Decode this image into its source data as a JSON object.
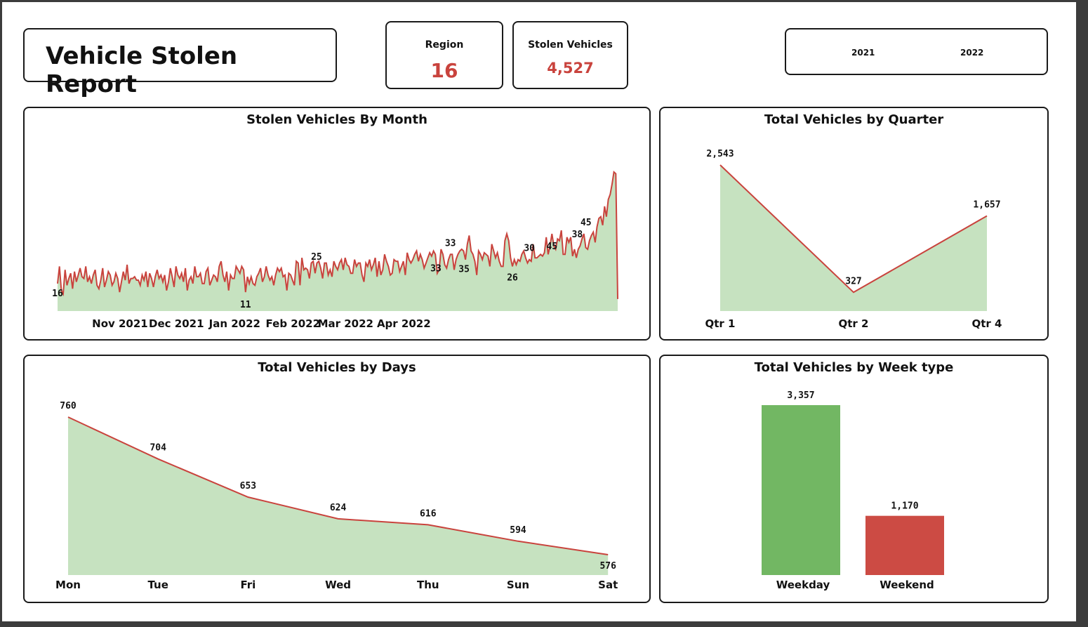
{
  "report": {
    "title": "Vehicle Stolen Report"
  },
  "kpis": {
    "region_label": "Region",
    "region_value": "16",
    "stolen_label": "Stolen Vehicles",
    "stolen_value": "4,527"
  },
  "year_slicer": {
    "options": [
      "2021",
      "2022"
    ]
  },
  "colors": {
    "area": "#c6e2c0",
    "line": "#c9433d",
    "weekday": "#72b763",
    "weekend": "#cc4b44"
  },
  "chart_data": [
    {
      "type": "area",
      "title": "Stolen Vehicles By Month",
      "x_ticks": [
        "Nov 2021",
        "Dec 2021",
        "Jan 2022",
        "Feb 2022",
        "Mar 2022",
        "Apr 2022"
      ],
      "start_date": "2021-10-07",
      "values": [
        16,
        26,
        12,
        10,
        24,
        15,
        19,
        22,
        13,
        23,
        17,
        21,
        25,
        20,
        19,
        26,
        17,
        20,
        16,
        21,
        24,
        15,
        13,
        18,
        25,
        14,
        18,
        23,
        21,
        15,
        17,
        22,
        19,
        11,
        17,
        23,
        18,
        27,
        16,
        19,
        19,
        20,
        18,
        18,
        15,
        21,
        18,
        23,
        14,
        22,
        19,
        14,
        20,
        24,
        19,
        21,
        17,
        21,
        12,
        17,
        25,
        20,
        14,
        26,
        21,
        19,
        22,
        17,
        25,
        12,
        18,
        20,
        16,
        26,
        20,
        20,
        22,
        16,
        16,
        23,
        25,
        15,
        18,
        21,
        20,
        17,
        26,
        29,
        21,
        17,
        23,
        12,
        21,
        19,
        19,
        26,
        24,
        22,
        26,
        24,
        11,
        20,
        16,
        20,
        16,
        15,
        20,
        22,
        25,
        17,
        20,
        26,
        21,
        18,
        20,
        15,
        21,
        25,
        23,
        25,
        20,
        21,
        12,
        22,
        21,
        18,
        15,
        29,
        28,
        15,
        31,
        24,
        25,
        24,
        19,
        28,
        29,
        22,
        28,
        29,
        25,
        19,
        28,
        28,
        21,
        24,
        20,
        29,
        26,
        24,
        28,
        30,
        24,
        31,
        27,
        26,
        22,
        22,
        30,
        26,
        28,
        28,
        21,
        17,
        28,
        26,
        30,
        24,
        27,
        31,
        20,
        29,
        21,
        24,
        33,
        29,
        26,
        21,
        22,
        30,
        29,
        29,
        23,
        26,
        29,
        21,
        34,
        30,
        28,
        30,
        33,
        35,
        29,
        33,
        30,
        25,
        28,
        31,
        34,
        32,
        35,
        33,
        22,
        24,
        36,
        33,
        27,
        25,
        30,
        33,
        33,
        24,
        30,
        33,
        35,
        36,
        35,
        30,
        39,
        44,
        35,
        33,
        29,
        21,
        35,
        33,
        30,
        34,
        33,
        32,
        26,
        39,
        35,
        31,
        34,
        29,
        26,
        26,
        41,
        45,
        41,
        31,
        26,
        30,
        27,
        30,
        29,
        33,
        35,
        31,
        28,
        30,
        29,
        39,
        31,
        31,
        32,
        33,
        32,
        34,
        43,
        33,
        38,
        45,
        38,
        36,
        42,
        41,
        47,
        33,
        33,
        43,
        40,
        43,
        32,
        36,
        31,
        36,
        38,
        42,
        45,
        37,
        36,
        41,
        44,
        46,
        40,
        49,
        54,
        55,
        50,
        61,
        55,
        65,
        68,
        74,
        81,
        80,
        7
      ]
    },
    {
      "type": "area",
      "title": "Total Vehicles by Quarter",
      "categories": [
        "Qtr 1",
        "Qtr 2",
        "Qtr 4"
      ],
      "values": [
        2543,
        327,
        1657
      ]
    },
    {
      "type": "area",
      "title": "Total Vehicles by Days",
      "categories": [
        "Mon",
        "Tue",
        "Fri",
        "Wed",
        "Thu",
        "Sun",
        "Sat"
      ],
      "values": [
        760,
        704,
        653,
        624,
        616,
        594,
        576
      ]
    },
    {
      "type": "bar",
      "title": "Total Vehicles by Week type",
      "categories": [
        "Weekday",
        "Weekend"
      ],
      "values": [
        3357,
        1170
      ]
    }
  ]
}
